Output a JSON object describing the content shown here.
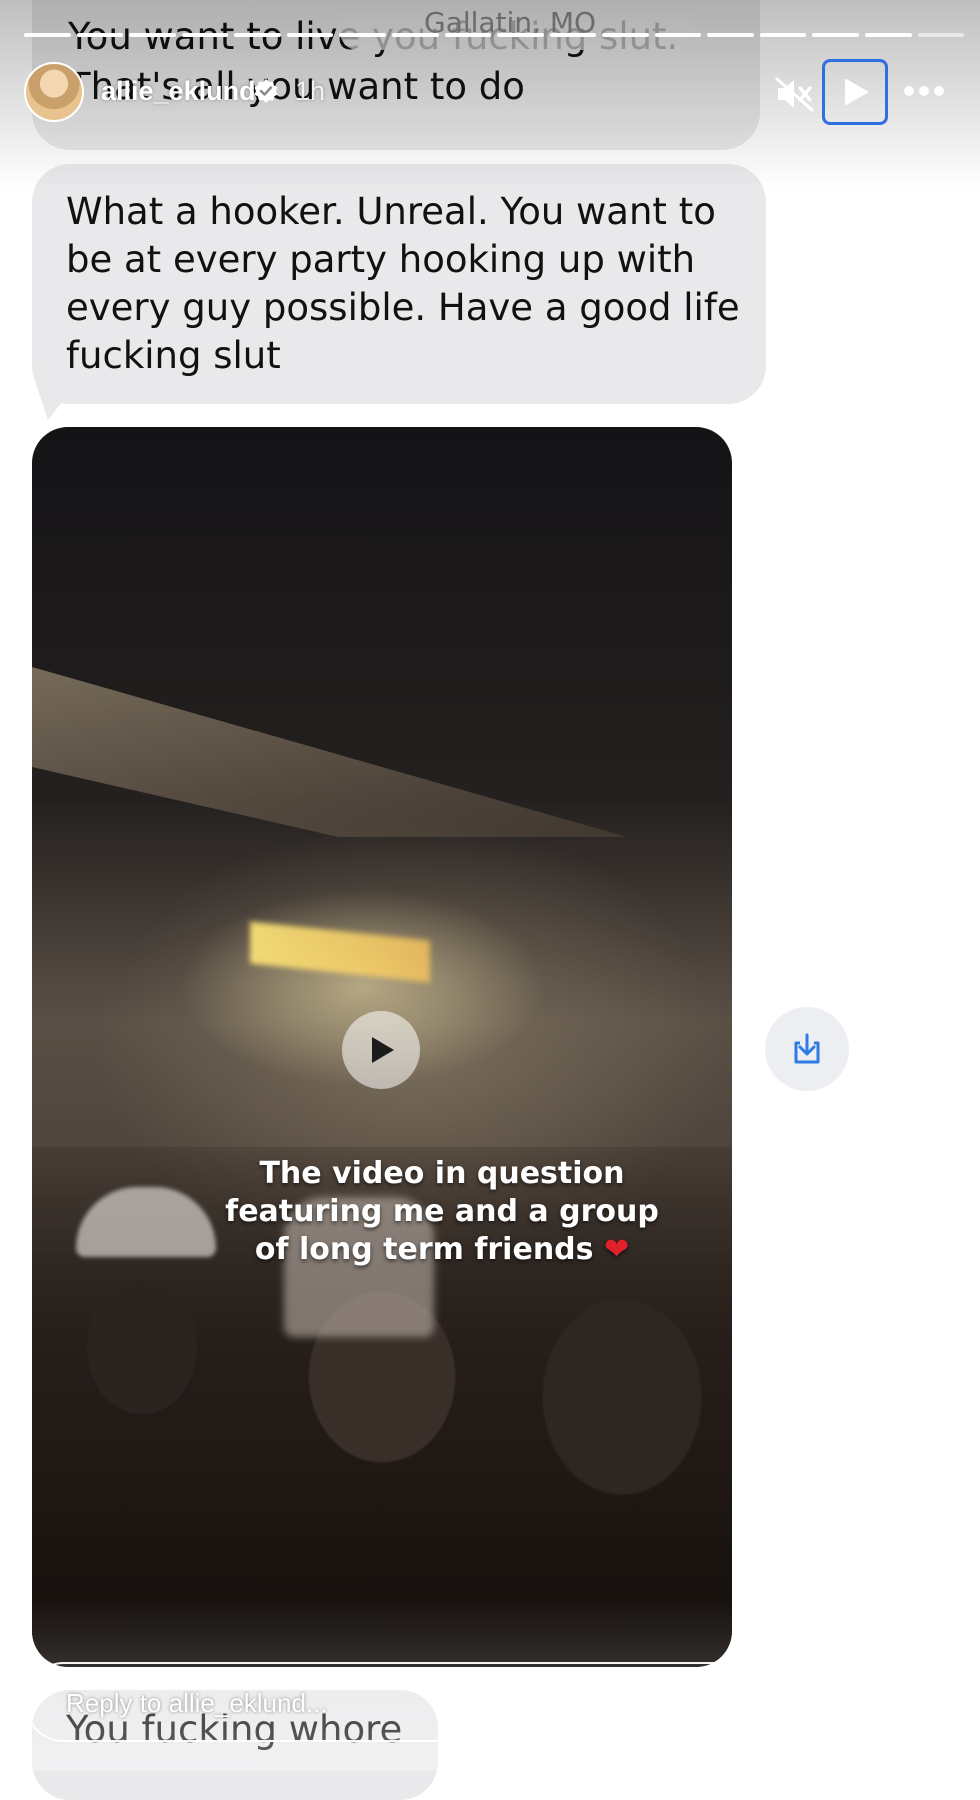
{
  "chat": {
    "top_message": "You want to live you fucking slut. That's all you want to do",
    "location": "Gallatin, MO",
    "main_message": "What a hooker. Unreal. You want to be at every party hooking up with every guy possible. Have a good life fucking slut",
    "bottom_message": "You fucking whore"
  },
  "story": {
    "username": "allie_eklund",
    "verified": true,
    "time_ago": "1h",
    "progress_segments_total": 18,
    "progress_segments_done": 17
  },
  "video": {
    "caption_line1": "The video in question",
    "caption_line2": "featuring me and a group",
    "caption_line3": "of long term friends",
    "caption_emoji": "❤"
  },
  "reply": {
    "placeholder": "Reply to allie_eklund..."
  },
  "icons": {
    "mute": "speaker-muted-icon",
    "play": "play-icon",
    "more": "more-horizontal-icon",
    "download": "download-icon",
    "like": "heart-icon",
    "share": "send-icon"
  },
  "colors": {
    "bubble": "#e9e9eb",
    "download_icon": "#2f7be6",
    "focus_outline": "#2f6fe0"
  }
}
